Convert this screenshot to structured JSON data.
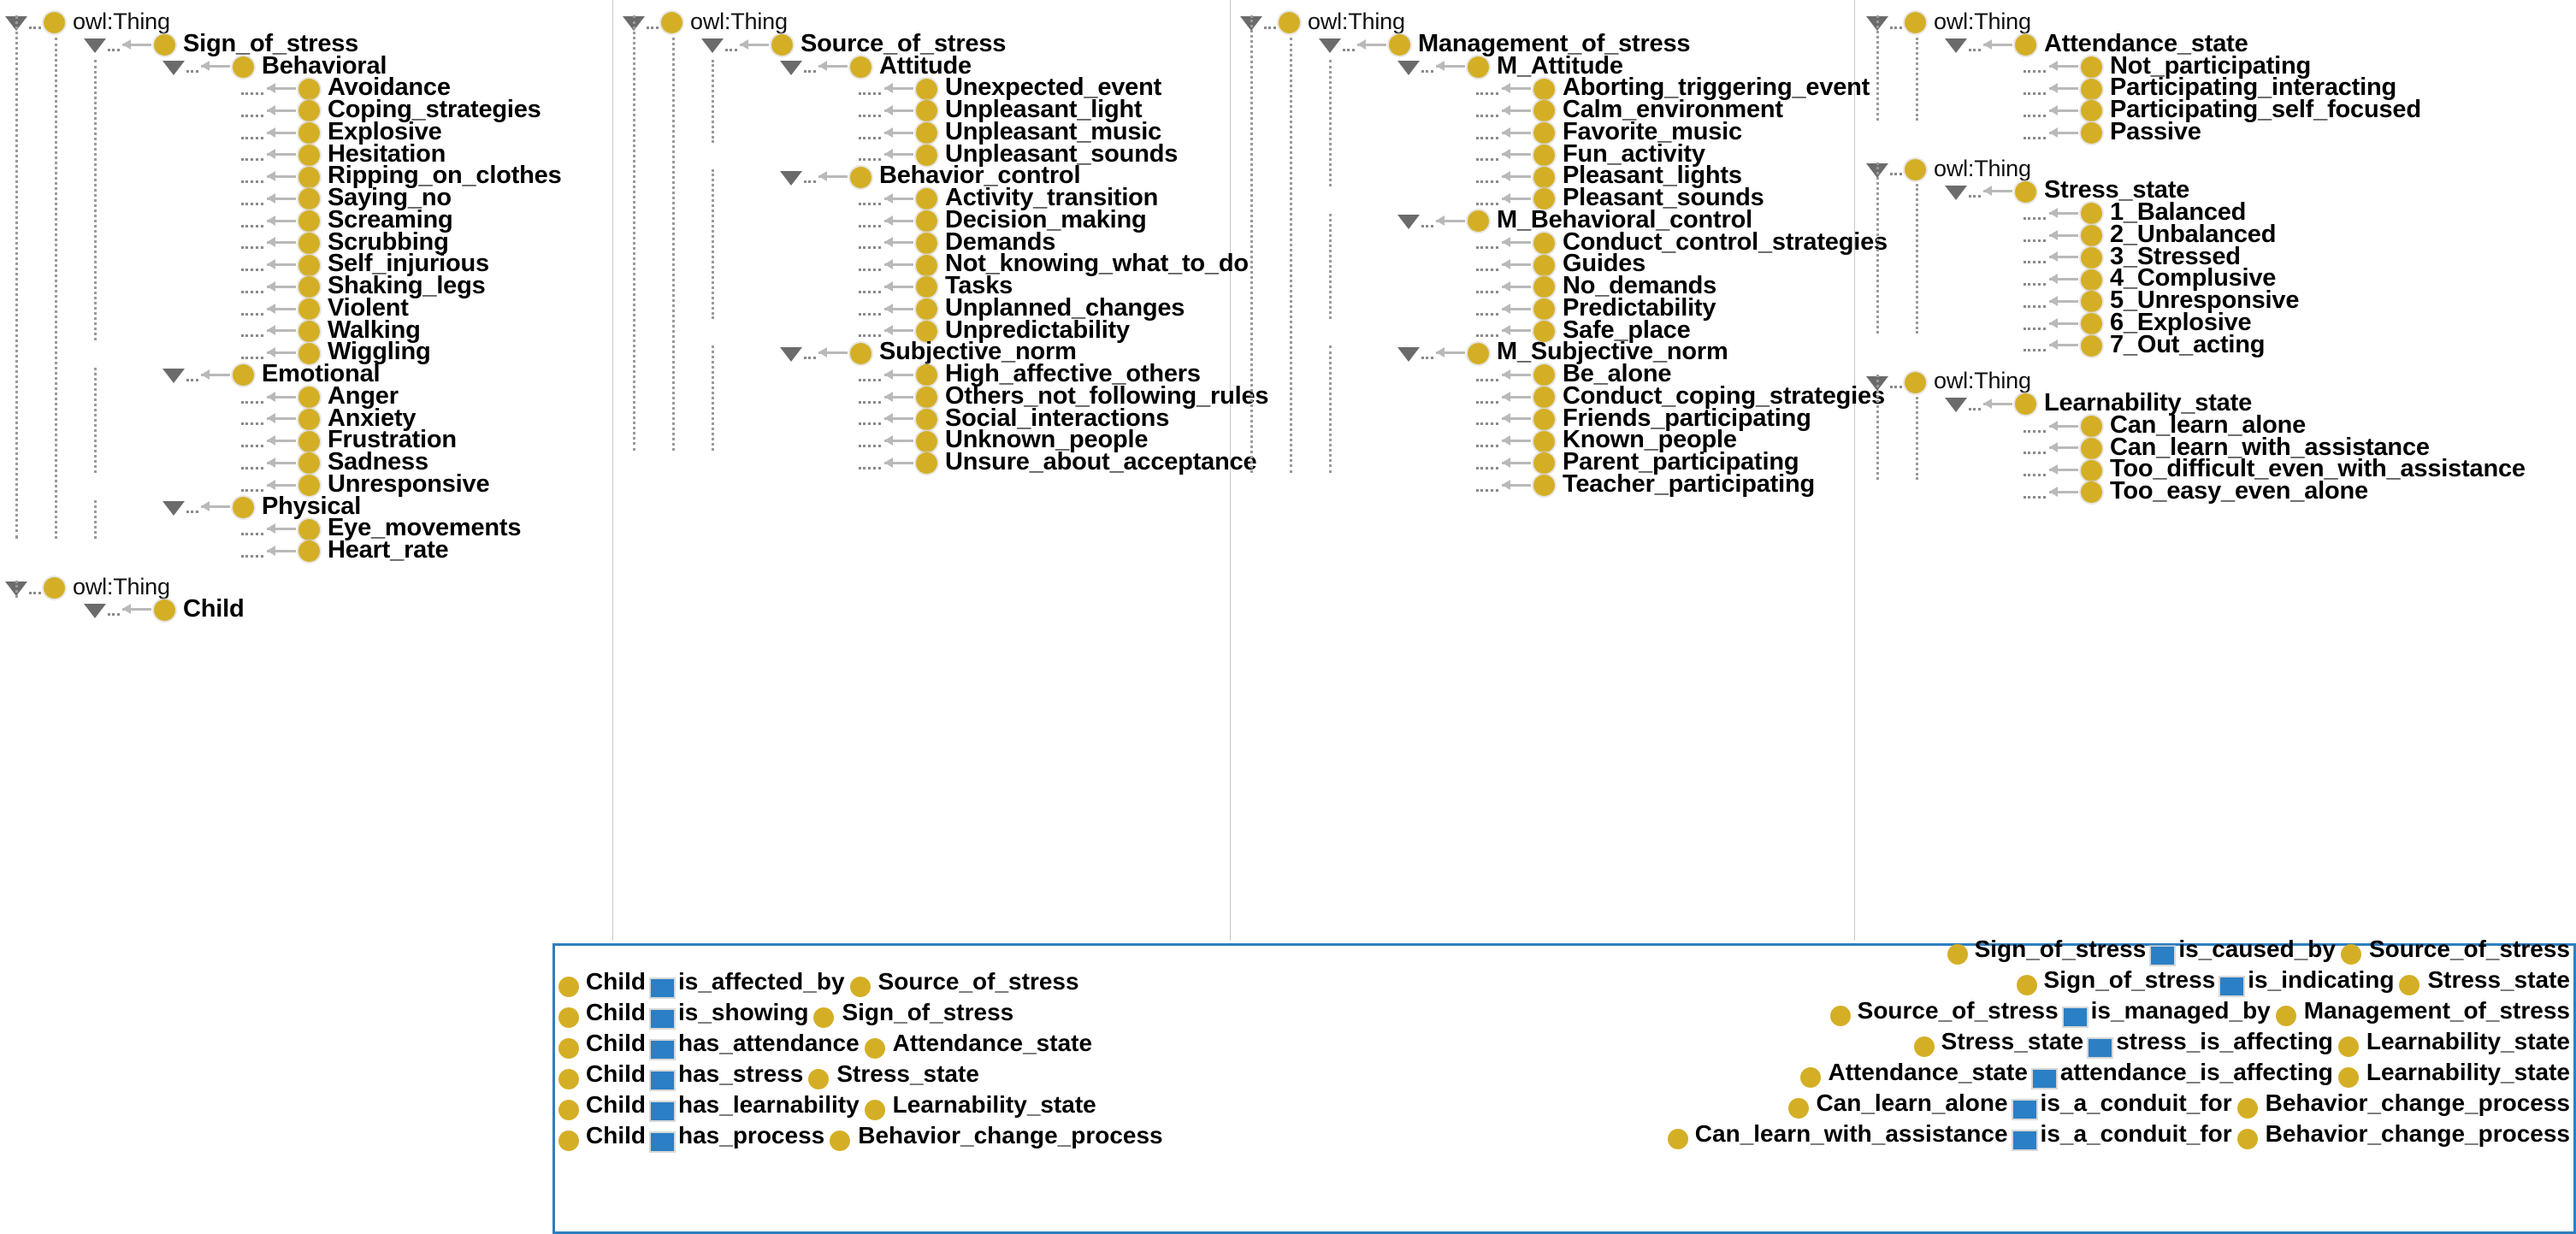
{
  "colors": {
    "class_node": "#d4af25",
    "property_node": "#2b7fc4",
    "legend_border": "#2d7fc1",
    "edge_arrow": "#b9b9b9",
    "tree_guide": "#9a9a9a"
  },
  "root_label": "owl:Thing",
  "columns": [
    {
      "name": "sign-of-stress-column",
      "trees": [
        {
          "root": "owl:Thing",
          "nodes": [
            {
              "label": "Sign_of_stress",
              "depth": 1,
              "expanded": true
            },
            {
              "label": "Behavioral",
              "depth": 2,
              "expanded": true
            },
            {
              "label": "Avoidance",
              "depth": 3,
              "expanded": false
            },
            {
              "label": "Coping_strategies",
              "depth": 3,
              "expanded": false
            },
            {
              "label": "Explosive",
              "depth": 3,
              "expanded": false
            },
            {
              "label": "Hesitation",
              "depth": 3,
              "expanded": false
            },
            {
              "label": "Ripping_on_clothes",
              "depth": 3,
              "expanded": false
            },
            {
              "label": "Saying_no",
              "depth": 3,
              "expanded": false
            },
            {
              "label": "Screaming",
              "depth": 3,
              "expanded": false
            },
            {
              "label": "Scrubbing",
              "depth": 3,
              "expanded": false
            },
            {
              "label": "Self_injurious",
              "depth": 3,
              "expanded": false
            },
            {
              "label": "Shaking_legs",
              "depth": 3,
              "expanded": false
            },
            {
              "label": "Violent",
              "depth": 3,
              "expanded": false
            },
            {
              "label": "Walking",
              "depth": 3,
              "expanded": false
            },
            {
              "label": "Wiggling",
              "depth": 3,
              "expanded": false
            },
            {
              "label": "Emotional",
              "depth": 2,
              "expanded": true
            },
            {
              "label": "Anger",
              "depth": 3,
              "expanded": false
            },
            {
              "label": "Anxiety",
              "depth": 3,
              "expanded": false
            },
            {
              "label": "Frustration",
              "depth": 3,
              "expanded": false
            },
            {
              "label": "Sadness",
              "depth": 3,
              "expanded": false
            },
            {
              "label": "Unresponsive",
              "depth": 3,
              "expanded": false
            },
            {
              "label": "Physical",
              "depth": 2,
              "expanded": true
            },
            {
              "label": "Eye_movements",
              "depth": 3,
              "expanded": false
            },
            {
              "label": "Heart_rate",
              "depth": 3,
              "expanded": false
            }
          ]
        },
        {
          "root": "owl:Thing",
          "nodes": [
            {
              "label": "Child",
              "depth": 1,
              "expanded": true
            }
          ]
        }
      ]
    },
    {
      "name": "source-of-stress-column",
      "trees": [
        {
          "root": "owl:Thing",
          "nodes": [
            {
              "label": "Source_of_stress",
              "depth": 1,
              "expanded": true
            },
            {
              "label": "Attitude",
              "depth": 2,
              "expanded": true
            },
            {
              "label": "Unexpected_event",
              "depth": 3,
              "expanded": false
            },
            {
              "label": "Unpleasant_light",
              "depth": 3,
              "expanded": false
            },
            {
              "label": "Unpleasant_music",
              "depth": 3,
              "expanded": false
            },
            {
              "label": "Unpleasant_sounds",
              "depth": 3,
              "expanded": false
            },
            {
              "label": "Behavior_control",
              "depth": 2,
              "expanded": true
            },
            {
              "label": "Activity_transition",
              "depth": 3,
              "expanded": false
            },
            {
              "label": "Decision_making",
              "depth": 3,
              "expanded": false
            },
            {
              "label": "Demands",
              "depth": 3,
              "expanded": false
            },
            {
              "label": "Not_knowing_what_to_do",
              "depth": 3,
              "expanded": false
            },
            {
              "label": "Tasks",
              "depth": 3,
              "expanded": false
            },
            {
              "label": "Unplanned_changes",
              "depth": 3,
              "expanded": false
            },
            {
              "label": "Unpredictability",
              "depth": 3,
              "expanded": false
            },
            {
              "label": "Subjective_norm",
              "depth": 2,
              "expanded": true
            },
            {
              "label": "High_affective_others",
              "depth": 3,
              "expanded": false
            },
            {
              "label": "Others_not_following_rules",
              "depth": 3,
              "expanded": false
            },
            {
              "label": "Social_interactions",
              "depth": 3,
              "expanded": false
            },
            {
              "label": "Unknown_people",
              "depth": 3,
              "expanded": false
            },
            {
              "label": "Unsure_about_acceptance",
              "depth": 3,
              "expanded": false
            }
          ]
        }
      ]
    },
    {
      "name": "management-of-stress-column",
      "trees": [
        {
          "root": "owl:Thing",
          "nodes": [
            {
              "label": "Management_of_stress",
              "depth": 1,
              "expanded": true
            },
            {
              "label": "M_Attitude",
              "depth": 2,
              "expanded": true
            },
            {
              "label": "Aborting_triggering_event",
              "depth": 3,
              "expanded": false
            },
            {
              "label": "Calm_environment",
              "depth": 3,
              "expanded": false
            },
            {
              "label": "Favorite_music",
              "depth": 3,
              "expanded": false
            },
            {
              "label": "Fun_activity",
              "depth": 3,
              "expanded": false
            },
            {
              "label": "Pleasant_lights",
              "depth": 3,
              "expanded": false
            },
            {
              "label": "Pleasant_sounds",
              "depth": 3,
              "expanded": false
            },
            {
              "label": "M_Behavioral_control",
              "depth": 2,
              "expanded": true
            },
            {
              "label": "Conduct_control_strategies",
              "depth": 3,
              "expanded": false
            },
            {
              "label": "Guides",
              "depth": 3,
              "expanded": false
            },
            {
              "label": "No_demands",
              "depth": 3,
              "expanded": false
            },
            {
              "label": "Predictability",
              "depth": 3,
              "expanded": false
            },
            {
              "label": "Safe_place",
              "depth": 3,
              "expanded": false
            },
            {
              "label": "M_Subjective_norm",
              "depth": 2,
              "expanded": true
            },
            {
              "label": "Be_alone",
              "depth": 3,
              "expanded": false
            },
            {
              "label": "Conduct_coping_strategies",
              "depth": 3,
              "expanded": false
            },
            {
              "label": "Friends_participating",
              "depth": 3,
              "expanded": false
            },
            {
              "label": "Known_people",
              "depth": 3,
              "expanded": false
            },
            {
              "label": "Parent_participating",
              "depth": 3,
              "expanded": false
            },
            {
              "label": "Teacher_participating",
              "depth": 3,
              "expanded": false
            }
          ]
        }
      ]
    },
    {
      "name": "states-column",
      "trees": [
        {
          "root": "owl:Thing",
          "nodes": [
            {
              "label": "Attendance_state",
              "depth": 1,
              "expanded": true
            },
            {
              "label": "Not_participating",
              "depth": 2,
              "expanded": false
            },
            {
              "label": "Participating_interacting",
              "depth": 2,
              "expanded": false
            },
            {
              "label": "Participating_self_focused",
              "depth": 2,
              "expanded": false
            },
            {
              "label": "Passive",
              "depth": 2,
              "expanded": false
            }
          ]
        },
        {
          "root": "owl:Thing",
          "nodes": [
            {
              "label": "Stress_state",
              "depth": 1,
              "expanded": true
            },
            {
              "label": "1_Balanced",
              "depth": 2,
              "expanded": false
            },
            {
              "label": "2_Unbalanced",
              "depth": 2,
              "expanded": false
            },
            {
              "label": "3_Stressed",
              "depth": 2,
              "expanded": false
            },
            {
              "label": "4_Complusive",
              "depth": 2,
              "expanded": false
            },
            {
              "label": "5_Unresponsive",
              "depth": 2,
              "expanded": false
            },
            {
              "label": "6_Explosive",
              "depth": 2,
              "expanded": false
            },
            {
              "label": "7_Out_acting",
              "depth": 2,
              "expanded": false
            }
          ]
        },
        {
          "root": "owl:Thing",
          "nodes": [
            {
              "label": "Learnability_state",
              "depth": 1,
              "expanded": true
            },
            {
              "label": "Can_learn_alone",
              "depth": 2,
              "expanded": false
            },
            {
              "label": "Can_learn_with_assistance",
              "depth": 2,
              "expanded": false
            },
            {
              "label": "Too_difficult_even_with_assistance",
              "depth": 2,
              "expanded": false
            },
            {
              "label": "Too_easy_even_alone",
              "depth": 2,
              "expanded": false
            }
          ]
        }
      ]
    }
  ],
  "legend": {
    "left_relations": [
      {
        "subject": "Child",
        "predicate": "is_affected_by",
        "object": "Source_of_stress"
      },
      {
        "subject": "Child",
        "predicate": "is_showing",
        "object": "Sign_of_stress"
      },
      {
        "subject": "Child",
        "predicate": "has_attendance",
        "object": "Attendance_state"
      },
      {
        "subject": "Child",
        "predicate": "has_stress",
        "object": "Stress_state"
      },
      {
        "subject": "Child",
        "predicate": "has_learnability",
        "object": "Learnability_state"
      },
      {
        "subject": "Child",
        "predicate": "has_process",
        "object": "Behavior_change_process"
      }
    ],
    "right_relations": [
      {
        "subject": "Sign_of_stress",
        "predicate": "is_caused_by",
        "object": "Source_of_stress"
      },
      {
        "subject": "Sign_of_stress",
        "predicate": "is_indicating",
        "object": "Stress_state"
      },
      {
        "subject": "Source_of_stress",
        "predicate": "is_managed_by",
        "object": "Management_of_stress"
      },
      {
        "subject": "Stress_state",
        "predicate": "stress_is_affecting",
        "object": "Learnability_state"
      },
      {
        "subject": "Attendance_state",
        "predicate": "attendance_is_affecting",
        "object": "Learnability_state"
      },
      {
        "subject": "Can_learn_alone",
        "predicate": "is_a_conduit_for",
        "object": "Behavior_change_process"
      },
      {
        "subject": "Can_learn_with_assistance",
        "predicate": "is_a_conduit_for",
        "object": "Behavior_change_process"
      }
    ]
  }
}
